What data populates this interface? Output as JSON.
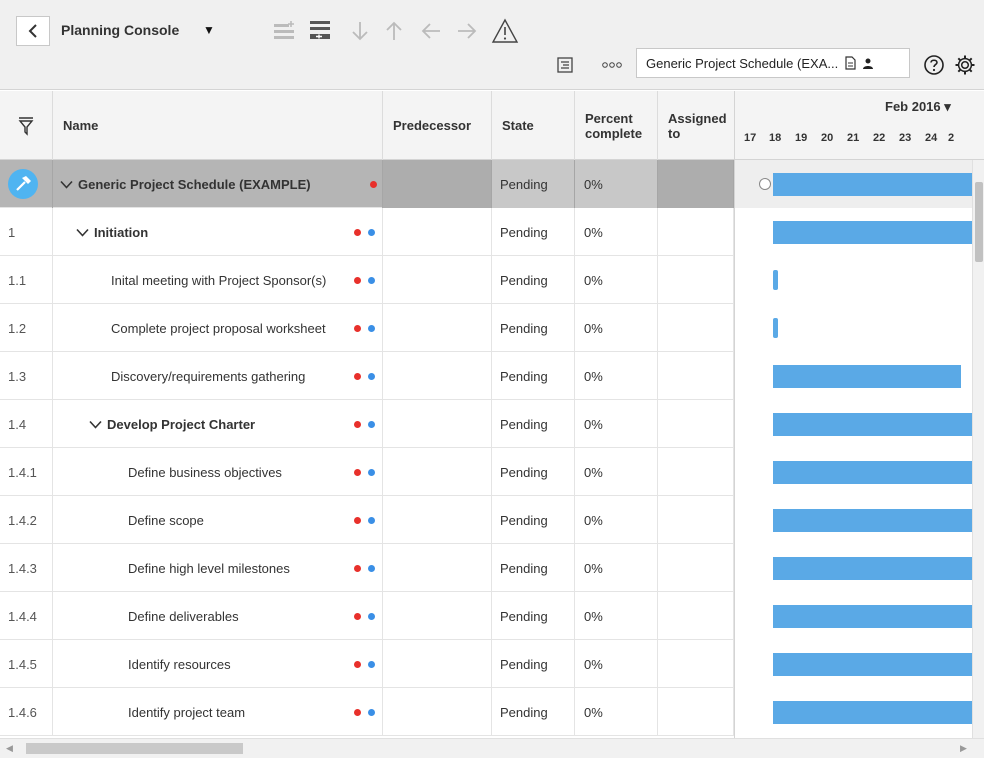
{
  "toolbar": {
    "title": "Planning Console",
    "caret": "▼",
    "plan_selector": "Generic Project Schedule (EXA...",
    "icons": [
      "add-task-icon",
      "insert-row-icon",
      "arrow-down-icon",
      "arrow-up-icon",
      "outdent-icon",
      "indent-icon",
      "warning-icon",
      "outline-icon",
      "more-icon",
      "document-icon",
      "user-icon",
      "help-icon",
      "settings-icon"
    ]
  },
  "grid": {
    "headers": {
      "name": "Name",
      "predecessor": "Predecessor",
      "state": "State",
      "percent_line1": "Percent",
      "percent_line2": "complete",
      "assigned_line1": "Assigned",
      "assigned_line2": "to"
    },
    "rows": [
      {
        "wbs": "",
        "name": "Generic Project Schedule (EXAMPLE)",
        "state": "Pending",
        "percent": "0%"
      },
      {
        "wbs": "1",
        "name": "Initiation",
        "state": "Pending",
        "percent": "0%"
      },
      {
        "wbs": "1.1",
        "name": "Inital meeting with Project Sponsor(s)",
        "state": "Pending",
        "percent": "0%"
      },
      {
        "wbs": "1.2",
        "name": "Complete project proposal worksheet",
        "state": "Pending",
        "percent": "0%"
      },
      {
        "wbs": "1.3",
        "name": "Discovery/requirements gathering",
        "state": "Pending",
        "percent": "0%"
      },
      {
        "wbs": "1.4",
        "name": "Develop Project Charter",
        "state": "Pending",
        "percent": "0%"
      },
      {
        "wbs": "1.4.1",
        "name": "Define business objectives",
        "state": "Pending",
        "percent": "0%"
      },
      {
        "wbs": "1.4.2",
        "name": "Define scope",
        "state": "Pending",
        "percent": "0%"
      },
      {
        "wbs": "1.4.3",
        "name": "Define high level milestones",
        "state": "Pending",
        "percent": "0%"
      },
      {
        "wbs": "1.4.4",
        "name": "Define deliverables",
        "state": "Pending",
        "percent": "0%"
      },
      {
        "wbs": "1.4.5",
        "name": "Identify resources",
        "state": "Pending",
        "percent": "0%"
      },
      {
        "wbs": "1.4.6",
        "name": "Identify project team",
        "state": "Pending",
        "percent": "0%"
      }
    ]
  },
  "gantt": {
    "month": "Feb 2016 ▾",
    "days": [
      "17",
      "18",
      "19",
      "20",
      "21",
      "22",
      "23",
      "24",
      "2"
    ]
  },
  "colors": {
    "bar": "#5aa9e6",
    "dot_red": "#e8302b",
    "dot_blue": "#3a8fe6",
    "selected_row": "#b5b5b5",
    "badge": "#4fb4f1"
  }
}
